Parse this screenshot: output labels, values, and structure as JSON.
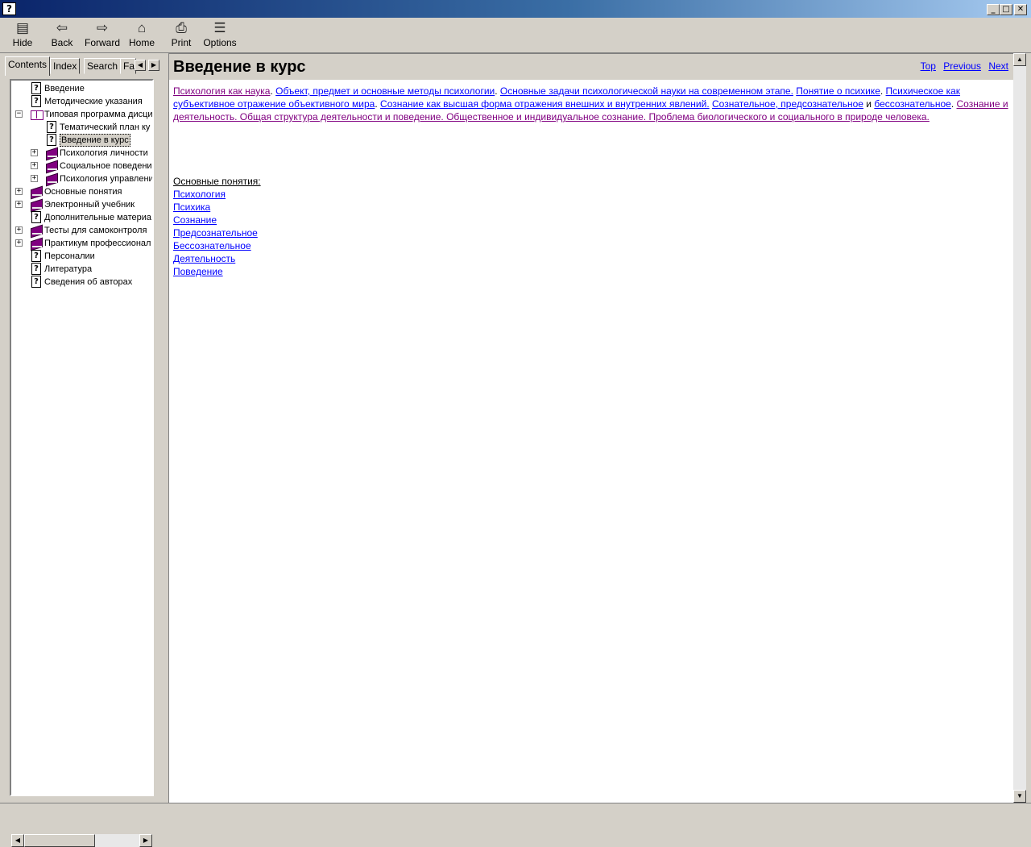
{
  "window": {
    "app_icon": "help-book-icon",
    "controls": {
      "minimize": "_",
      "maximize": "□",
      "close": "✕"
    }
  },
  "toolbar": {
    "buttons": [
      {
        "label": "Hide",
        "icon": "hide-icon",
        "glyph": "▤"
      },
      {
        "label": "Back",
        "icon": "back-arrow-icon",
        "glyph": "⇦"
      },
      {
        "label": "Forward",
        "icon": "forward-arrow-icon",
        "glyph": "⇨"
      },
      {
        "label": "Home",
        "icon": "home-icon",
        "glyph": "⌂"
      },
      {
        "label": "Print",
        "icon": "printer-icon",
        "glyph": "⎙"
      },
      {
        "label": "Options",
        "icon": "options-icon",
        "glyph": "☰"
      }
    ]
  },
  "nav": {
    "tabs": [
      "Contents",
      "Index",
      "Search",
      "Fa"
    ],
    "active_tab": "Contents",
    "tree": [
      {
        "label": "Введение",
        "type": "page",
        "level": 1,
        "expander": ""
      },
      {
        "label": "Методические указания",
        "type": "page",
        "level": 1,
        "expander": ""
      },
      {
        "label": "Типовая программа дисци",
        "type": "open-book",
        "level": 1,
        "expander": "−"
      },
      {
        "label": "Тематический план ку",
        "type": "page",
        "level": 2,
        "expander": ""
      },
      {
        "label": "Введение в курс",
        "type": "page",
        "level": 2,
        "expander": "",
        "selected": true
      },
      {
        "label": "Психология личности",
        "type": "book",
        "level": 2,
        "expander": "+"
      },
      {
        "label": "Социальное поведение",
        "type": "book",
        "level": 2,
        "expander": "+"
      },
      {
        "label": "Психология управлени",
        "type": "book",
        "level": 2,
        "expander": "+"
      },
      {
        "label": "Основные понятия",
        "type": "book",
        "level": 1,
        "expander": "+"
      },
      {
        "label": "Электронный учебник",
        "type": "book",
        "level": 1,
        "expander": "+"
      },
      {
        "label": "Дополнительные материа",
        "type": "page",
        "level": 1,
        "expander": ""
      },
      {
        "label": "Тесты для самоконтроля",
        "type": "book",
        "level": 1,
        "expander": "+"
      },
      {
        "label": "Практикум профессионал",
        "type": "book",
        "level": 1,
        "expander": "+"
      },
      {
        "label": "Персоналии",
        "type": "page",
        "level": 1,
        "expander": ""
      },
      {
        "label": "Литература",
        "type": "page",
        "level": 1,
        "expander": ""
      },
      {
        "label": "Сведения об авторах",
        "type": "page",
        "level": 1,
        "expander": ""
      }
    ]
  },
  "content": {
    "title": "Введение в курс",
    "nav_links": [
      "Top",
      "Previous",
      "Next"
    ],
    "topics": [
      {
        "text": "Психология как наука",
        "visited": true,
        "sep": ". "
      },
      {
        "text": "Объект, предмет и основные методы психологии",
        "visited": false,
        "sep": ". "
      },
      {
        "text": "Основные задачи психологической науки на современном этапе.",
        "visited": false,
        "sep": " "
      },
      {
        "text": "Понятие о психике",
        "visited": false,
        "sep": ". "
      },
      {
        "text": "Психическое как субъективное отражение объективного мира",
        "visited": false,
        "sep": ". "
      },
      {
        "text": "Сознание как высшая форма отражения внешних и внутренних явлений.",
        "visited": false,
        "sep": " "
      },
      {
        "text": "Сознательное, предсознательное",
        "visited": false,
        "sep": " и "
      },
      {
        "text": "бессознательное",
        "visited": false,
        "sep": ". "
      },
      {
        "text": "Сознание и деятельность. Общая структура деятельности и поведение. Общественное и индивидуальное сознание. Проблема биологического и социального в природе человека.",
        "visited": true,
        "sep": ""
      }
    ],
    "concepts_heading": "Основные понятия:",
    "concepts": [
      "Психология",
      "Психика",
      "Сознание",
      "Предсознательное",
      "Бессознательное",
      "Деятельность",
      "Поведение"
    ]
  }
}
